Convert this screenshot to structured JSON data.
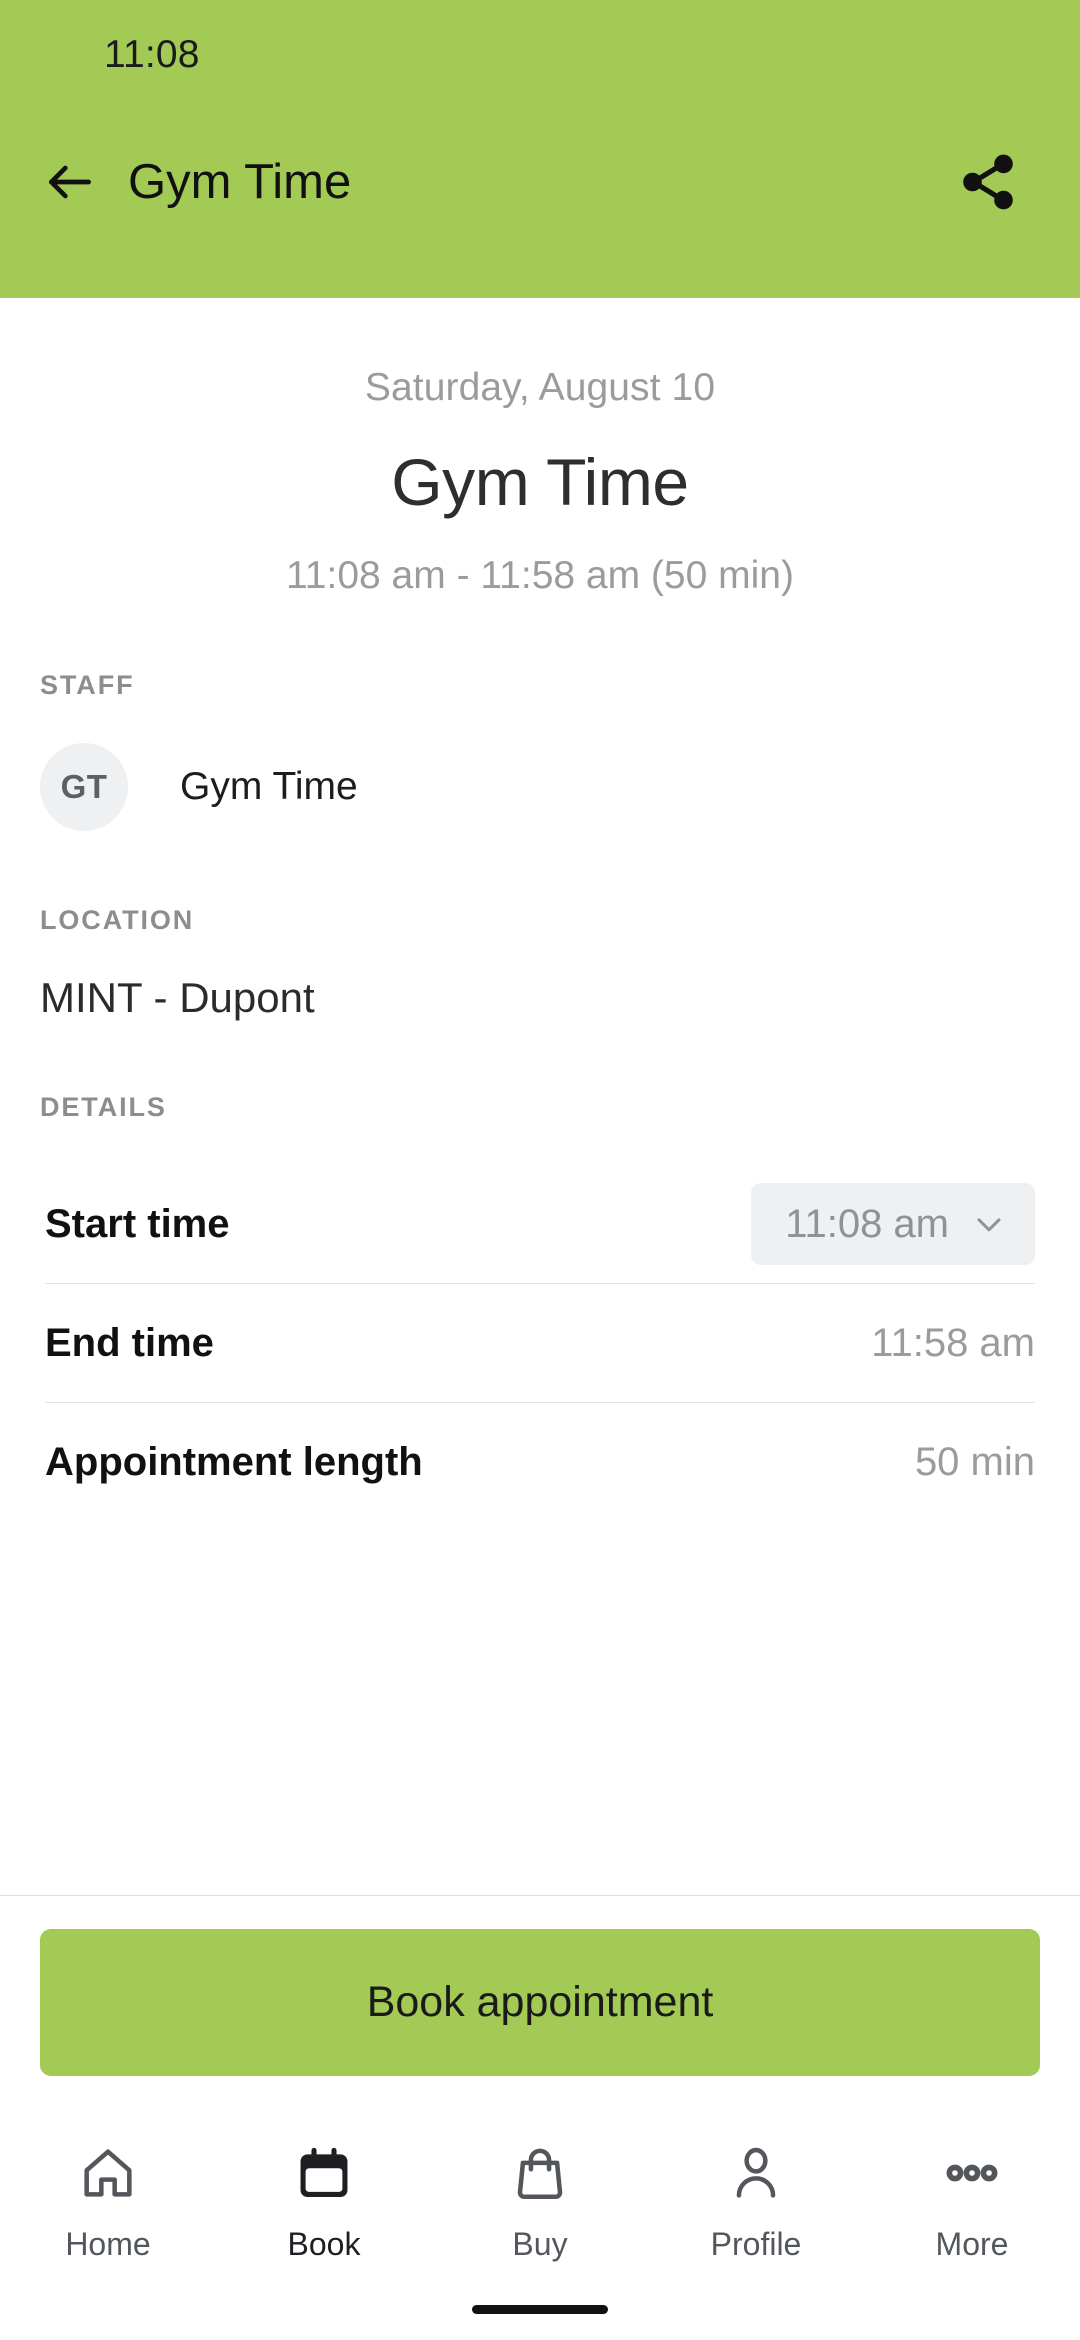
{
  "status_bar": {
    "time": "11:08"
  },
  "app_bar": {
    "title": "Gym Time",
    "back_icon": "arrow-left-icon",
    "share_icon": "share-icon",
    "background_color": "#a3ca55"
  },
  "hero": {
    "date": "Saturday, August 10",
    "title": "Gym Time",
    "time_range": "11:08 am - 11:58 am (50 min)"
  },
  "staff": {
    "label": "STAFF",
    "avatar_initials": "GT",
    "name": "Gym Time"
  },
  "location": {
    "label": "LOCATION",
    "value": "MINT - Dupont"
  },
  "details": {
    "label": "DETAILS",
    "rows": [
      {
        "label": "Start time",
        "value": "11:08 am",
        "type": "dropdown",
        "icon": "chevron-down-icon"
      },
      {
        "label": "End time",
        "value": "11:58 am",
        "type": "text"
      },
      {
        "label": "Appointment length",
        "value": "50 min",
        "type": "text"
      }
    ]
  },
  "cta": {
    "label": "Book appointment",
    "background_color": "#a3ca55"
  },
  "bottom_nav": {
    "items": [
      {
        "label": "Home",
        "icon": "home-icon",
        "active": false
      },
      {
        "label": "Book",
        "icon": "calendar-icon",
        "active": true
      },
      {
        "label": "Buy",
        "icon": "bag-icon",
        "active": false
      },
      {
        "label": "Profile",
        "icon": "person-icon",
        "active": false
      },
      {
        "label": "More",
        "icon": "ellipsis-icon",
        "active": false
      }
    ]
  },
  "colors": {
    "brand_green": "#a3ca55",
    "muted_text": "#9b9b9b",
    "chip_bg": "#eef0f2"
  }
}
